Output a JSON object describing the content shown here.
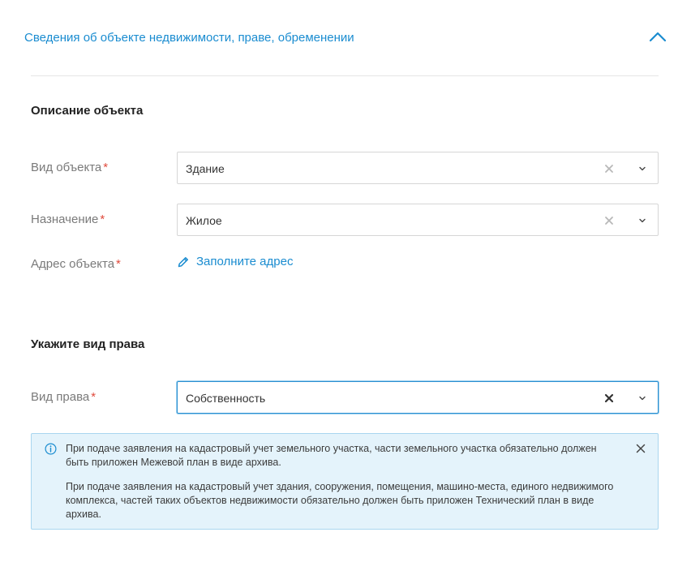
{
  "accordion": {
    "title": "Сведения об объекте недвижимости, праве, обременении",
    "icon": "chevron-up-icon",
    "accent_color": "#1a8cd0"
  },
  "object_section": {
    "title": "Описание объекта",
    "fields": {
      "object_type": {
        "label": "Вид объекта",
        "required_mark": "*",
        "value": "Здание"
      },
      "purpose": {
        "label": "Назначение",
        "required_mark": "*",
        "value": "Жилое"
      },
      "address": {
        "label": "Адрес объекта",
        "required_mark": "*",
        "link_text": "Заполните адрес",
        "icon": "pencil-icon"
      }
    }
  },
  "right_section": {
    "title": "Укажите вид права",
    "fields": {
      "right_type": {
        "label": "Вид права",
        "required_mark": "*",
        "value": "Собственность"
      }
    }
  },
  "info_notice": {
    "icon": "info-icon",
    "close_icon": "close-icon",
    "paragraph1": "При подаче заявления на кадастровый учет земельного участка, части земельного участка обязательно должен быть приложен Межевой план в виде архива.",
    "paragraph2": "При подаче заявления на кадастровый учет здания, сооружения, помещения, машино-места, единого недвижимого комплекса, частей таких объектов недвижимости обязательно должен быть приложен Технический план в виде архива.",
    "background_color": "#e4f3fb",
    "border_color": "#a9d6ef"
  },
  "colors": {
    "required": "#e04a3c",
    "label": "#7a7a7a",
    "link": "#1a8cd0"
  }
}
